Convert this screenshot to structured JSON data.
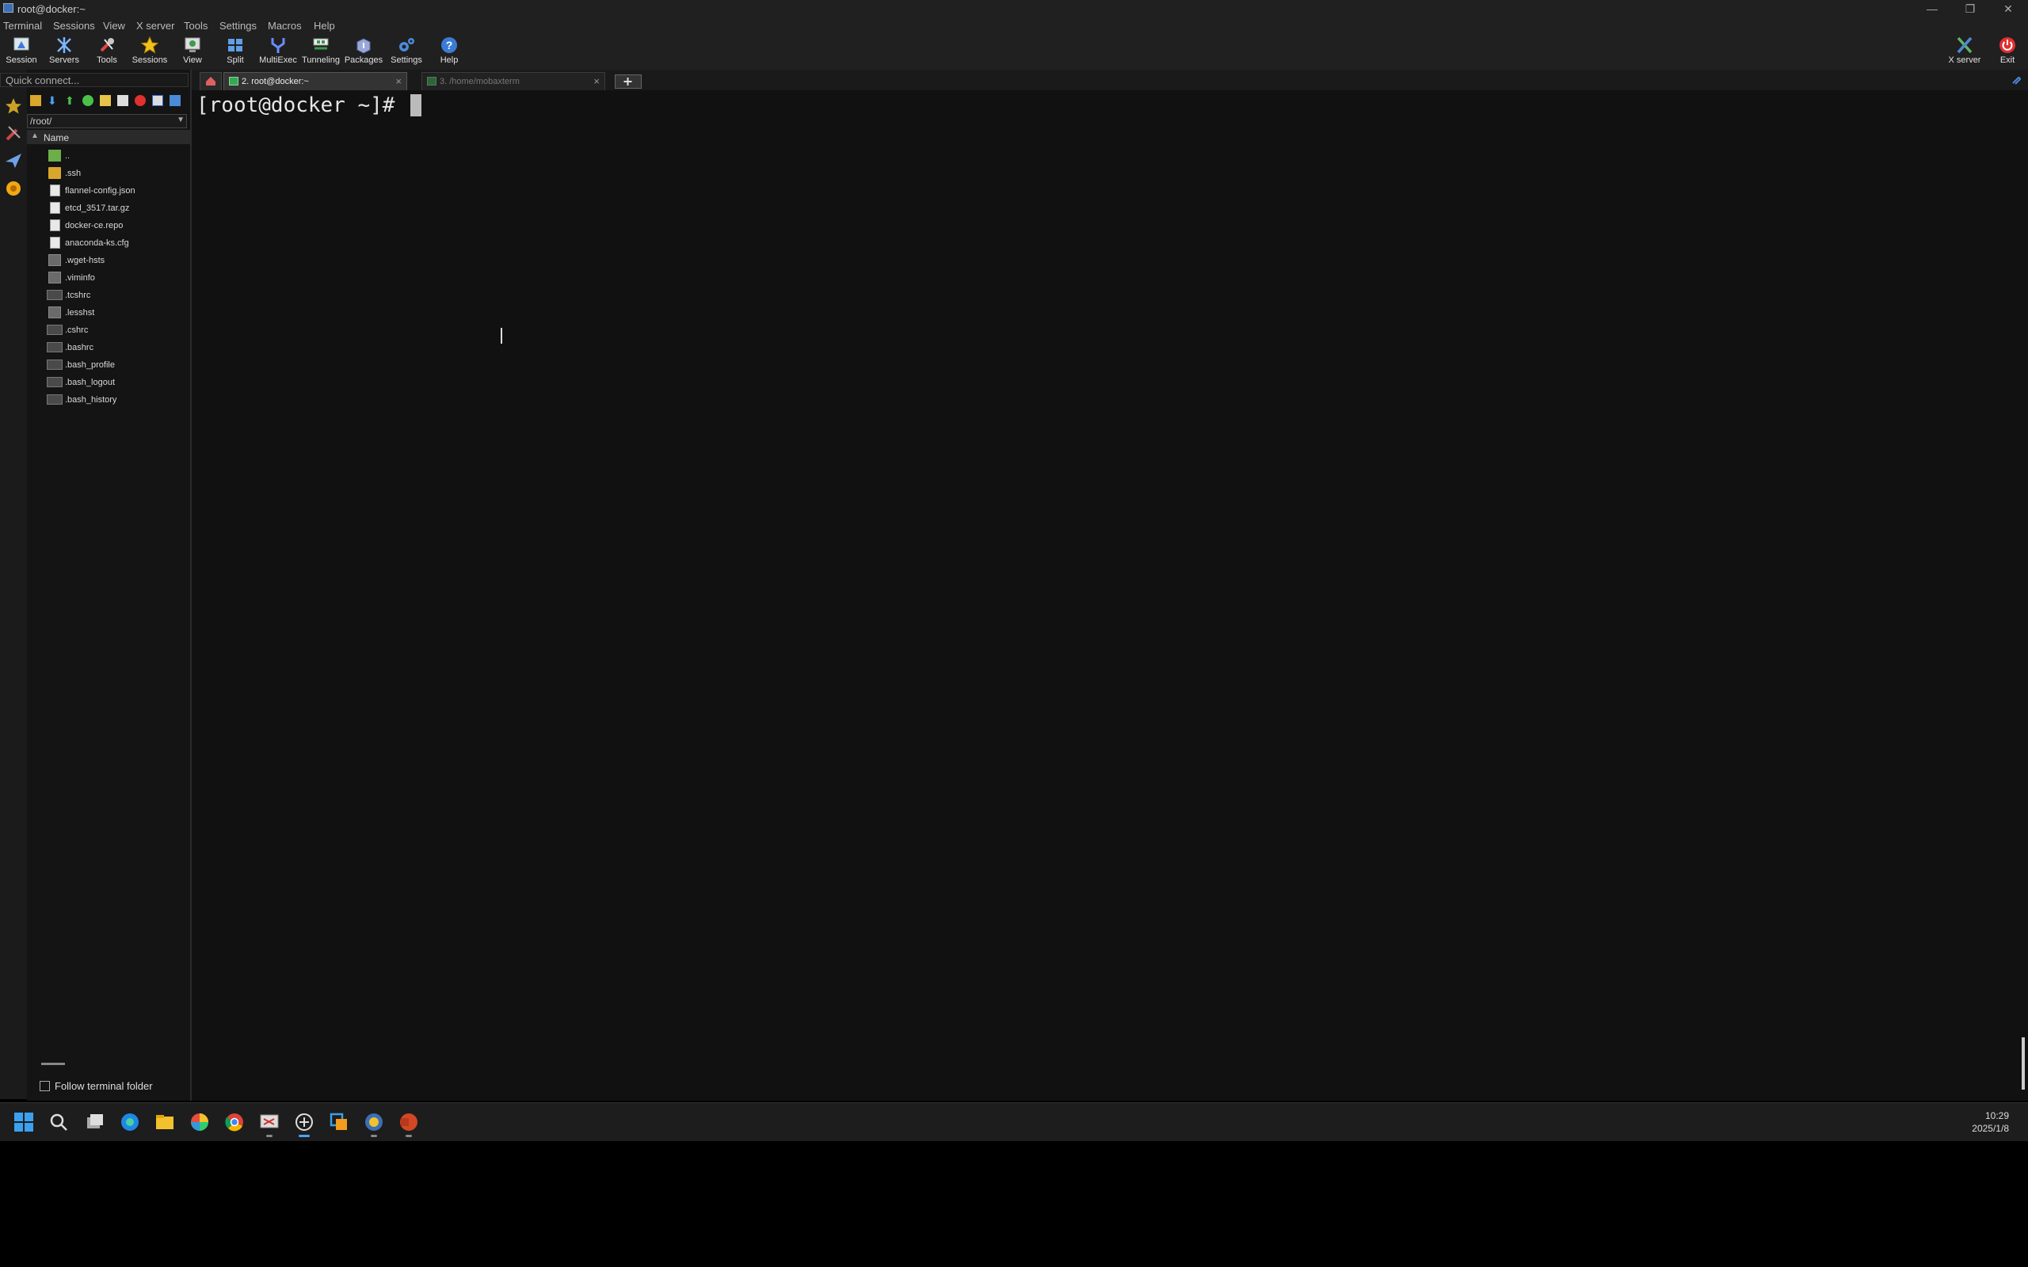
{
  "window": {
    "title": "root@docker:~",
    "minimize": "—",
    "maximize": "❐",
    "close": "✕"
  },
  "menu": [
    "Terminal",
    "Sessions",
    "View",
    "X server",
    "Tools",
    "Settings",
    "Macros",
    "Help"
  ],
  "toolbar": {
    "items": [
      "Session",
      "Servers",
      "Tools",
      "Sessions",
      "View",
      "Split",
      "MultiExec",
      "Tunneling",
      "Packages",
      "Settings",
      "Help"
    ],
    "right": [
      "X server",
      "Exit"
    ]
  },
  "sidebar": {
    "quick_connect_placeholder": "Quick connect...",
    "path": "/root/",
    "column_name": "Name",
    "files": [
      {
        "name": "..",
        "type": "up"
      },
      {
        "name": ".ssh",
        "type": "folder"
      },
      {
        "name": "flannel-config.json",
        "type": "doc"
      },
      {
        "name": "etcd_3517.tar.gz",
        "type": "doc"
      },
      {
        "name": "docker-ce.repo",
        "type": "doc"
      },
      {
        "name": "anaconda-ks.cfg",
        "type": "doc"
      },
      {
        "name": ".wget-hsts",
        "type": "gray"
      },
      {
        "name": ".viminfo",
        "type": "gray"
      },
      {
        "name": ".tcshrc",
        "type": "dark"
      },
      {
        "name": ".lesshst",
        "type": "gray"
      },
      {
        "name": ".cshrc",
        "type": "dark"
      },
      {
        "name": ".bashrc",
        "type": "dark"
      },
      {
        "name": ".bash_profile",
        "type": "dark"
      },
      {
        "name": ".bash_logout",
        "type": "dark"
      },
      {
        "name": ".bash_history",
        "type": "dark"
      }
    ],
    "follow_label": "Follow terminal folder"
  },
  "tabs": {
    "active": "2. root@docker:~",
    "inactive": "3. /home/mobaxterm",
    "close": "×"
  },
  "terminal": {
    "prompt": "[root@docker ~]# "
  },
  "taskbar": {
    "time": "10:29",
    "date": "2025/1/8"
  },
  "colors": {
    "accent": "#3b7bd6",
    "exit": "#e03030",
    "folder": "#d9a72b"
  }
}
